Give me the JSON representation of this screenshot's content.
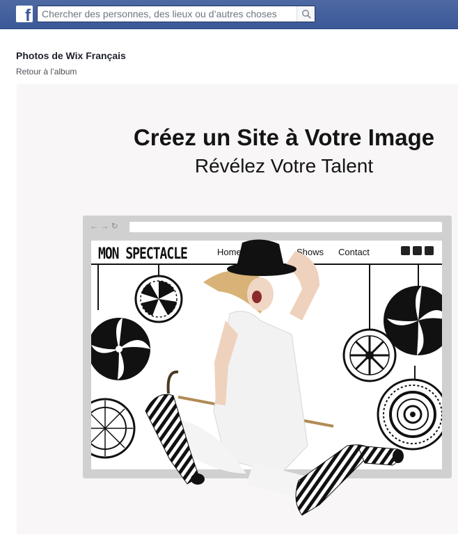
{
  "header": {
    "logo_letter": "f",
    "search": {
      "placeholder": "Chercher des personnes, des lieux ou d’autres choses"
    }
  },
  "album": {
    "title": "Photos de Wix Français",
    "back_link": "Retour à l’album"
  },
  "photo": {
    "headline": "Créez un Site à Votre Image",
    "subline": "Révélez Votre Talent",
    "browser_nav_glyphs": "← → ↻",
    "site": {
      "logo": "MON SPECTACLE",
      "nav": {
        "home": "Home",
        "shows": "Shows",
        "contact": "Contact"
      }
    }
  },
  "colors": {
    "topbar": "#3b5998",
    "title_text": "#1d2129",
    "link_text": "#4b4f56"
  },
  "icons": {
    "logo": "facebook-logo-icon",
    "search": "magnifier-icon",
    "social": [
      "instagram-icon",
      "youtube-icon",
      "google-plus-icon"
    ]
  }
}
